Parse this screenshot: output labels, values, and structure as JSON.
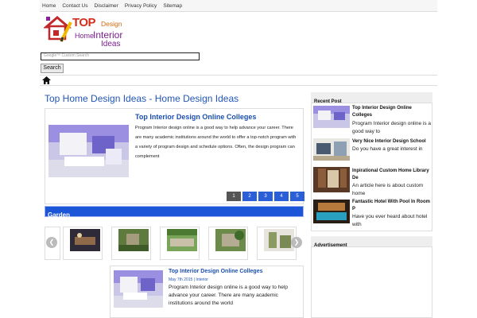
{
  "topnav": {
    "items": [
      "Home",
      "Contact Us",
      "Disclaimer",
      "Privacy Policy",
      "Sitemap"
    ]
  },
  "logo": {
    "top": "TOP",
    "design": "Design",
    "home": "Home",
    "interior": "Interior",
    "ideas": "Ideas"
  },
  "search": {
    "placeholder": "Google™ Custom Search",
    "button": "Search"
  },
  "main": {
    "title": "Top Home Design Ideas - Home Design Ideas",
    "feature": {
      "title": "Top Interior Design Online Colleges",
      "text": "Program Interior design online is a good way to help advance your career. There are many academic institutions around the world to offer a top-notch program with a variety of program design and schedule options. Often, the design program can complement"
    },
    "pager": [
      "1",
      "2",
      "3",
      "4",
      "5"
    ],
    "section": "Garden",
    "carousel": {
      "prev": "❮",
      "next": "❯"
    },
    "post": {
      "title": "Top Interior Design Online Colleges",
      "date": "May 7th 2015",
      "separator": "|",
      "category": "Interior",
      "text": "Program Interior design online is a good way to help advance your career. There are many academic institutions around the world"
    }
  },
  "sidebar": {
    "recent_heading": "Recent Post",
    "posts": [
      {
        "title": "Top Interior Design Online Colleges",
        "text": "Program Interior design online is a good way to"
      },
      {
        "title": "Very Nice Interior Design School",
        "text": "Do you have a great interest in"
      },
      {
        "title": "Inpirational Custom Home Library De",
        "text": "An article here is about custom home"
      },
      {
        "title": "Fantastic Hotel With Pool In Room P",
        "text": "Have you ever heard about hotel with"
      }
    ],
    "ad_heading": "Advertisement"
  },
  "colors": {
    "accent": "#1d55d8",
    "link": "#1b4fb0",
    "logo_red": "#d42d1a",
    "logo_purple": "#7b1e8f"
  }
}
